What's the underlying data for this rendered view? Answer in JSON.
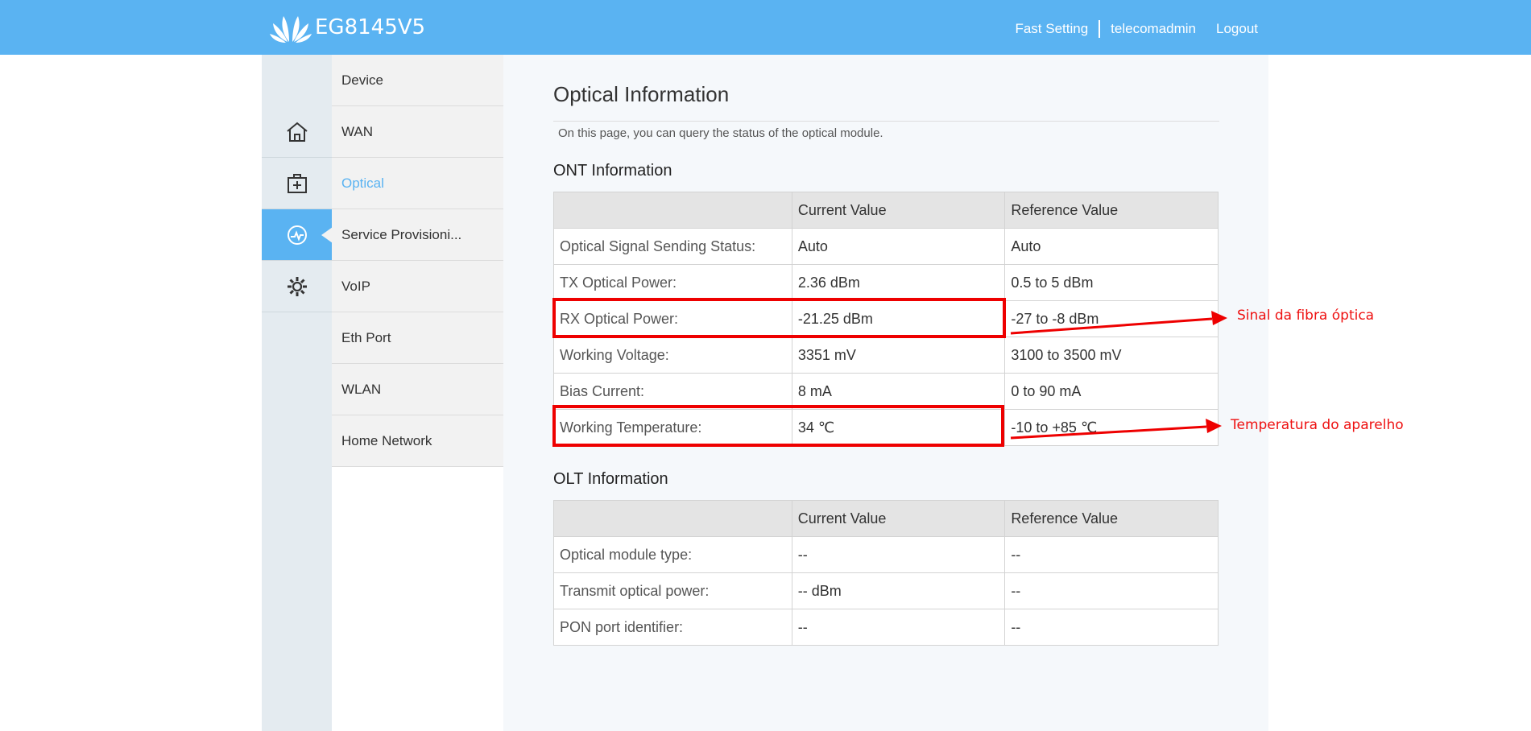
{
  "header": {
    "brand": "EG8145V5",
    "logo_icon": "huawei-flower-logo-icon",
    "fast_setting": "Fast Setting",
    "user": "telecomadmin",
    "logout": "Logout",
    "accent_color": "#5ab3f2"
  },
  "icon_rail": [
    {
      "icon": "home-icon",
      "active": false
    },
    {
      "icon": "medical-kit-icon",
      "active": false
    },
    {
      "icon": "status-pulse-icon",
      "active": true
    },
    {
      "icon": "gear-icon",
      "active": false
    }
  ],
  "submenu": {
    "items": [
      "Device",
      "WAN",
      "Optical",
      "Service Provisioni...",
      "VoIP",
      "Eth Port",
      "WLAN",
      "Home Network"
    ],
    "active": "Optical"
  },
  "main": {
    "title": "Optical Information",
    "description": "On this page, you can query the status of the optical module.",
    "ont": {
      "title": "ONT Information",
      "headers": [
        "",
        "Current Value",
        "Reference Value"
      ],
      "rows": [
        [
          "Optical Signal Sending Status:",
          "Auto",
          "Auto"
        ],
        [
          "TX Optical Power:",
          "2.36 dBm",
          "0.5 to 5 dBm"
        ],
        [
          "RX Optical Power:",
          "-21.25 dBm",
          "-27 to -8 dBm"
        ],
        [
          "Working Voltage:",
          "3351 mV",
          "3100 to 3500 mV"
        ],
        [
          "Bias Current:",
          "8 mA",
          "0 to 90 mA"
        ],
        [
          "Working Temperature:",
          "34 ℃",
          "-10 to +85 ℃"
        ]
      ]
    },
    "olt": {
      "title": "OLT Information",
      "headers": [
        "",
        "Current Value",
        "Reference Value"
      ],
      "rows": [
        [
          "Optical module type:",
          "--",
          "--"
        ],
        [
          "Transmit optical power:",
          "-- dBm",
          "--"
        ],
        [
          "PON port identifier:",
          "--",
          "--"
        ]
      ]
    }
  },
  "annotations": {
    "signal": "Sinal da fibra óptica",
    "temperature": "Temperatura do aparelho",
    "color": "#ee0000"
  }
}
